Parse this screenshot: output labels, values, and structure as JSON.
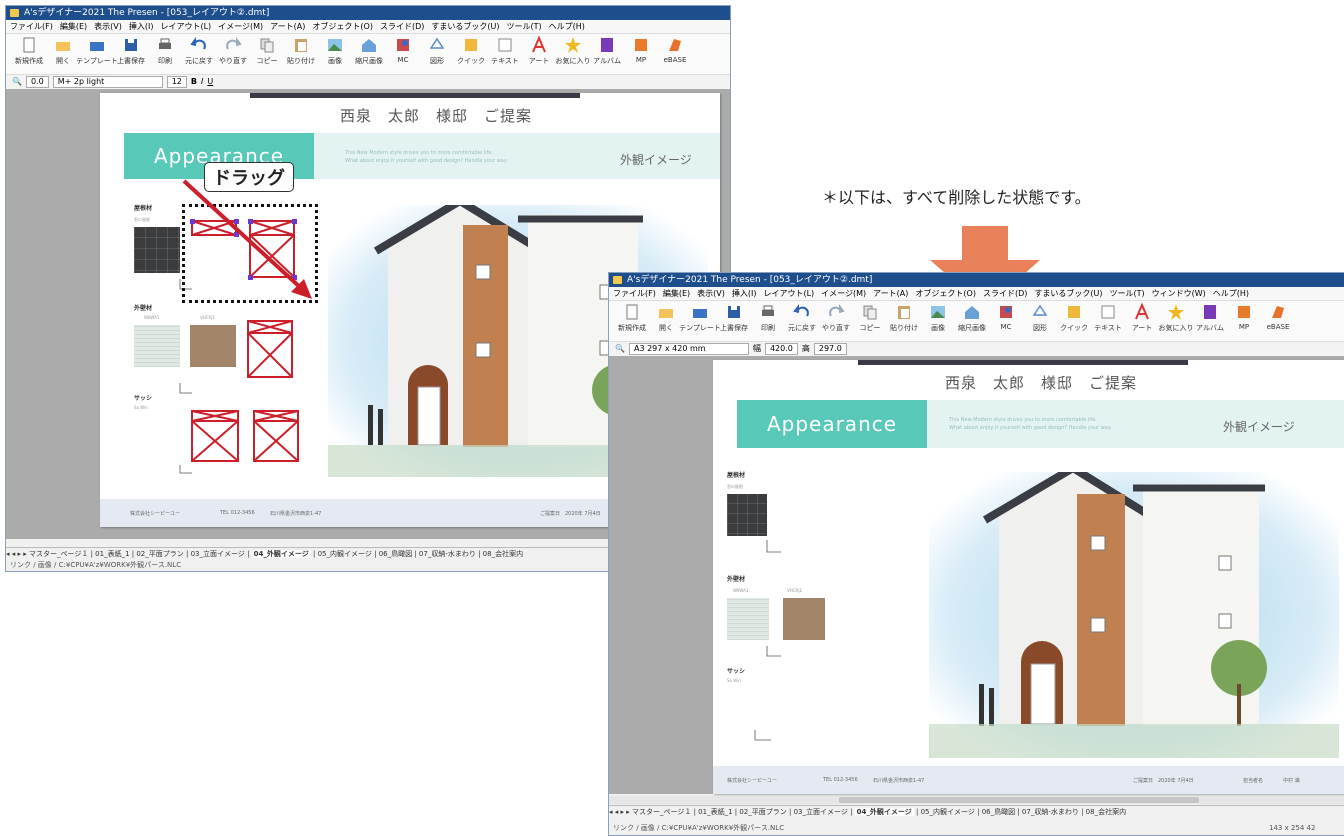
{
  "annotation": {
    "drag_label": "ドラッグ",
    "note": "＊以下は、すべて削除した状態です。",
    "arrow_color": "#e8805a",
    "selection_color": "#cc1f2a"
  },
  "window1": {
    "title": "A'sデザイナー2021 The Presen - [053_レイアウト②.dmt]",
    "menu": [
      "ファイル(F)",
      "編集(E)",
      "表示(V)",
      "挿入(I)",
      "レイアウト(L)",
      "イメージ(M)",
      "アート(A)",
      "オブジェクト(O)",
      "スライド(D)",
      "すまいるブック(U)",
      "ツール(T)",
      "ヘルプ(H)"
    ],
    "toolbar": [
      "新規作成",
      "開く",
      "テンプレート",
      "上書保存",
      "印刷",
      "元に戻す",
      "やり直す",
      "コピー",
      "貼り付け",
      "画像",
      "縮尺画像",
      "MC",
      "図形",
      "クイック",
      "テキスト",
      "アート",
      "お気に入り",
      "アルバム",
      "MP",
      "eBASE"
    ],
    "toolrow": {
      "zoom": "0.0",
      "font": "M+ 2p light",
      "size": "12"
    },
    "tabs": [
      "マスター_ページ１",
      "01_表紙_1",
      "02_平面プラン",
      "03_立面イメージ",
      "04_外観イメージ",
      "05_内観イメージ",
      "06_鳥瞰図",
      "07_収納-水まわり",
      "08_会社案内"
    ],
    "active_tab_index": 4,
    "status": "リンク / 画像 / C:¥CPU¥A'z¥WORK¥外観パース.NLC"
  },
  "window2": {
    "title": "A'sデザイナー2021 The Presen - [053_レイアウト②.dmt]",
    "menu": [
      "ファイル(F)",
      "編集(E)",
      "表示(V)",
      "挿入(I)",
      "レイアウト(L)",
      "イメージ(M)",
      "アート(A)",
      "オブジェクト(O)",
      "スライド(D)",
      "すまいるブック(U)",
      "ツール(T)",
      "ウィンドウ(W)",
      "ヘルプ(H)"
    ],
    "toolbar": [
      "新規作成",
      "開く",
      "テンプレート",
      "上書保存",
      "印刷",
      "元に戻す",
      "やり直す",
      "コピー",
      "貼り付け",
      "画像",
      "縮尺画像",
      "MC",
      "図形",
      "クイック",
      "テキスト",
      "アート",
      "お気に入り",
      "アルバム",
      "MP",
      "eBASE"
    ],
    "toolrow": {
      "paper": "A3 297 x 420 mm",
      "width_label": "幅",
      "width": "420.0",
      "height_label": "高",
      "height": "297.0"
    },
    "tabs": [
      "マスター_ページ１",
      "01_表紙_1",
      "02_平面プラン",
      "03_立面イメージ",
      "04_外観イメージ",
      "05_内観イメージ",
      "06_鳥瞰図",
      "07_収納-水まわり",
      "08_会社案内"
    ],
    "active_tab_index": 4,
    "status": "リンク / 画像 / C:¥CPU¥A'z¥WORK¥外観パース.NLC",
    "coords": "143 x 254   42"
  },
  "slide": {
    "title": "西泉　太郎　様邸　ご提案",
    "banner": "Appearance",
    "blurb_1": "This New Modern style drives you to more comfortable life.",
    "blurb_2": "What about enjoy it yourself with good design? Handle your way.",
    "heading": "外観イメージ",
    "roof_label": "屋根材",
    "roof_sub": "窓の屋根",
    "wall_label": "外壁材",
    "wall_sub_1": "WKWA1",
    "wall_sub_2": "VHCRJ1",
    "sash_label": "サッシ",
    "sash_sub": "Sa Win",
    "footer_company": "株式会社シーピーユー",
    "footer_tel": "TEL 012-3456",
    "footer_addr": "石川県金沢市西泉1-47",
    "footer_date": "ご提案日　2020年 7月4日",
    "footer_staff_label": "担当者名",
    "footer_staff": "中村 満"
  }
}
